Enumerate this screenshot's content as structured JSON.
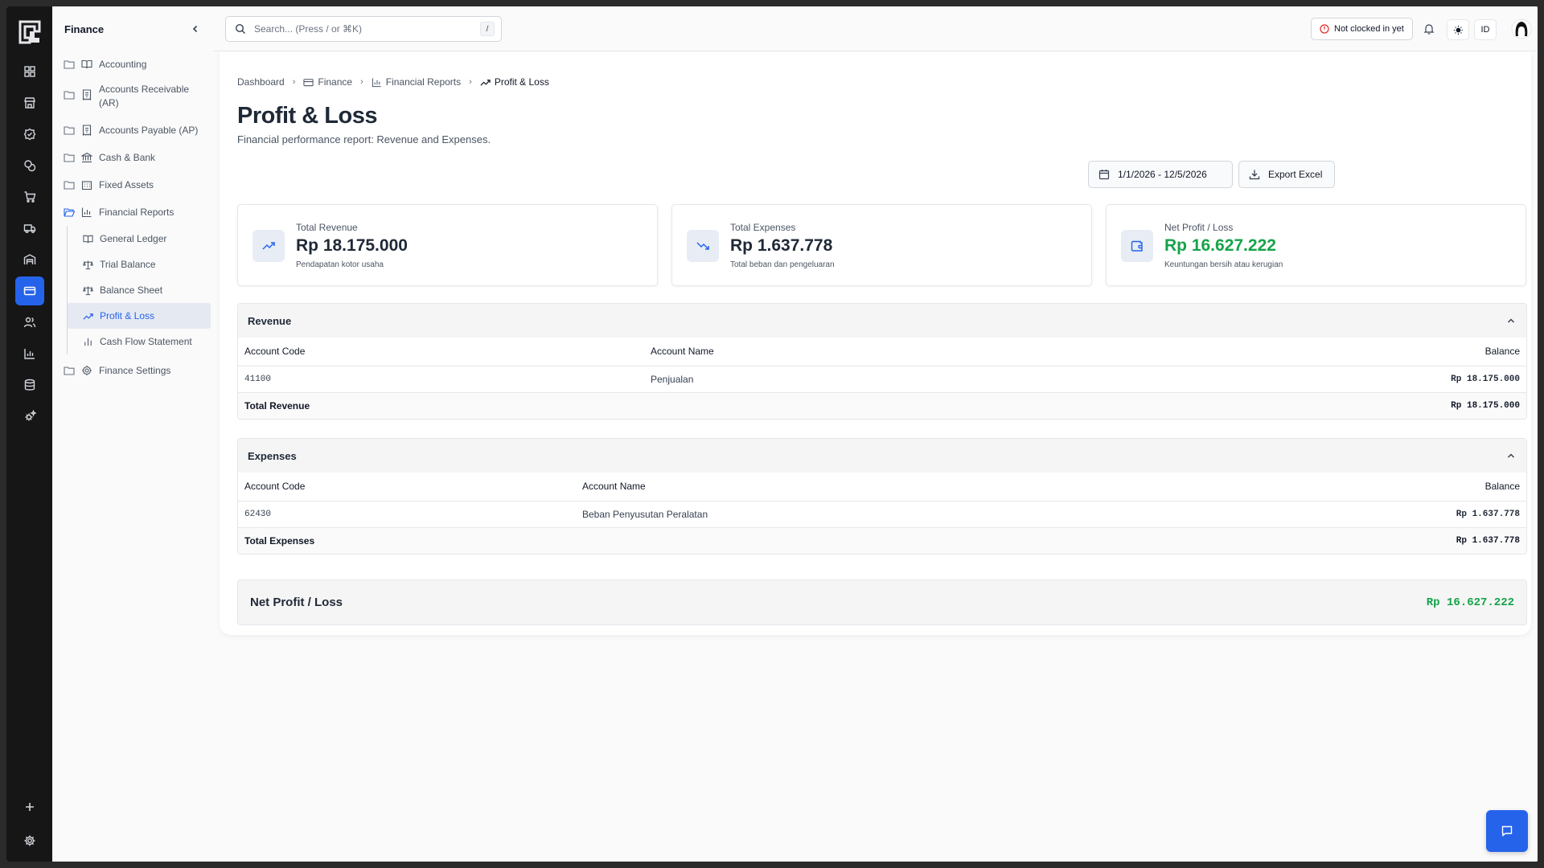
{
  "sidebar": {
    "title": "Finance",
    "items": [
      {
        "label": "Accounting",
        "icon": "book-icon"
      },
      {
        "label": "Accounts Receivable (AR)",
        "icon": "receipt-icon"
      },
      {
        "label": "Accounts Payable (AP)",
        "icon": "receipt-icon"
      },
      {
        "label": "Cash & Bank",
        "icon": "bank-icon"
      },
      {
        "label": "Fixed Assets",
        "icon": "building-icon"
      },
      {
        "label": "Financial Reports",
        "icon": "bar-chart-icon"
      }
    ],
    "subitems": [
      {
        "label": "General Ledger",
        "icon": "book-icon"
      },
      {
        "label": "Trial Balance",
        "icon": "scale-icon"
      },
      {
        "label": "Balance Sheet",
        "icon": "scale-icon"
      },
      {
        "label": "Profit & Loss",
        "icon": "trending-up-icon",
        "active": true
      },
      {
        "label": "Cash Flow Statement",
        "icon": "bar-chart-icon"
      }
    ],
    "settings": {
      "label": "Finance Settings",
      "icon": "gear-icon"
    }
  },
  "topbar": {
    "search_placeholder": "Search... (Press / or ⌘K)",
    "search_shortcut": "/",
    "clock_status": "Not clocked in yet",
    "language": "ID"
  },
  "breadcrumb": {
    "items": [
      "Dashboard",
      "Finance",
      "Financial Reports",
      "Profit & Loss"
    ]
  },
  "page": {
    "title": "Profit & Loss",
    "subtitle": "Financial performance report: Revenue and Expenses.",
    "date_range": "1/1/2026 - 12/5/2026",
    "export_label": "Export Excel"
  },
  "stats": [
    {
      "label": "Total Revenue",
      "value": "Rp 18.175.000",
      "desc": "Pendapatan kotor usaha",
      "icon": "trending-up-icon"
    },
    {
      "label": "Total Expenses",
      "value": "Rp 1.637.778",
      "desc": "Total beban dan pengeluaran",
      "icon": "trending-down-icon"
    },
    {
      "label": "Net Profit / Loss",
      "value": "Rp 16.627.222",
      "desc": "Keuntungan bersih atau kerugian",
      "icon": "wallet-icon"
    }
  ],
  "revenue": {
    "title": "Revenue",
    "columns": [
      "Account Code",
      "Account Name",
      "Balance"
    ],
    "rows": [
      {
        "code": "41100",
        "name": "Penjualan",
        "balance": "Rp 18.175.000"
      }
    ],
    "total_label": "Total Revenue",
    "total_value": "Rp 18.175.000"
  },
  "expenses": {
    "title": "Expenses",
    "columns": [
      "Account Code",
      "Account Name",
      "Balance"
    ],
    "rows": [
      {
        "code": "62430",
        "name": "Beban Penyusutan Peralatan",
        "balance": "Rp 1.637.778"
      }
    ],
    "total_label": "Total Expenses",
    "total_value": "Rp 1.637.778"
  },
  "net": {
    "label": "Net Profit / Loss",
    "value": "Rp 16.627.222"
  },
  "colors": {
    "accent": "#2563eb",
    "positive": "#16a34a",
    "rail": "#161616"
  }
}
